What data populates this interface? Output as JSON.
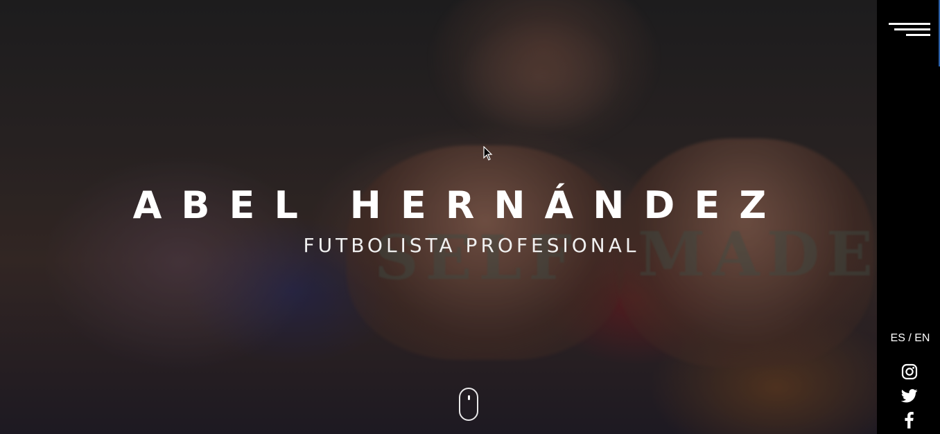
{
  "hero": {
    "title": "ABEL HERNÁNDEZ",
    "subtitle": "FUTBOLISTA PROFESIONAL",
    "scroll_indicator_icon": "mouse-scroll-icon"
  },
  "sidebar": {
    "menu_icon": "hamburger-menu-icon",
    "language": {
      "es_label": "ES",
      "separator": " / ",
      "en_label": "EN"
    },
    "social": [
      {
        "icon": "instagram-icon"
      },
      {
        "icon": "twitter-icon"
      },
      {
        "icon": "facebook-icon"
      }
    ]
  },
  "colors": {
    "sidebar_background": "#000000",
    "text": "#ffffff",
    "sidebar_edge_accent": "#2a5fa8"
  }
}
